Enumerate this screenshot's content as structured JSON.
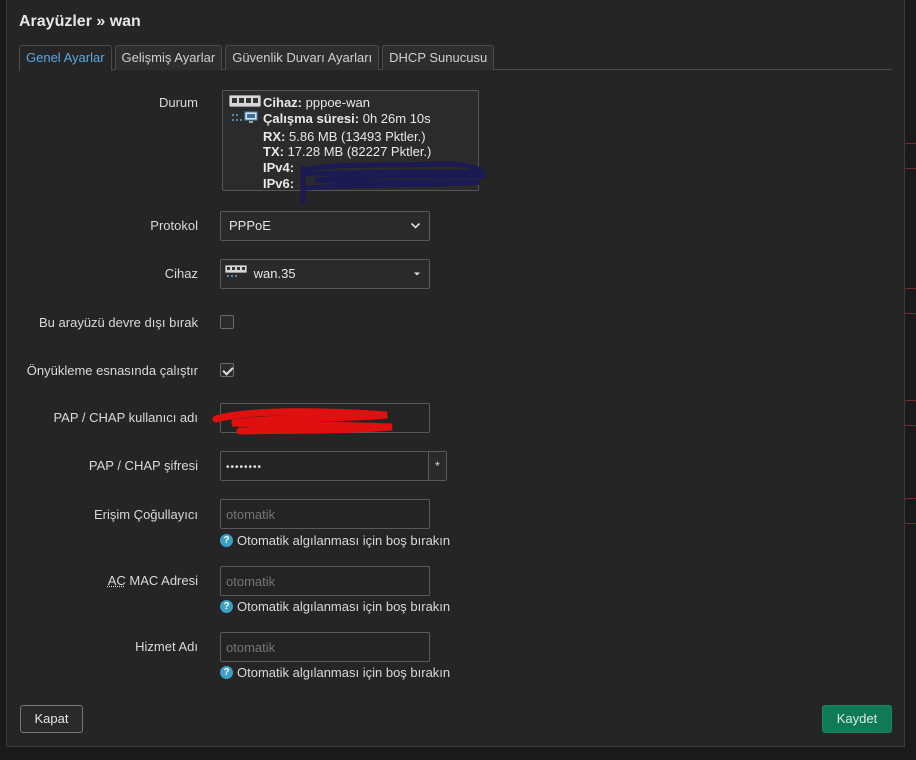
{
  "modal": {
    "title": "Arayüzler » wan"
  },
  "tabs": [
    {
      "label": "Genel Ayarlar",
      "active": true
    },
    {
      "label": "Gelişmiş Ayarlar",
      "active": false
    },
    {
      "label": "Güvenlik Duvarı Ayarları",
      "active": false
    },
    {
      "label": "DHCP Sunucusu",
      "active": false
    }
  ],
  "status": {
    "label": "Durum",
    "device_key": "Cihaz:",
    "device_value": "pppoe-wan",
    "uptime_key": "Çalışma süresi:",
    "uptime_value": "0h 26m 10s",
    "rx_key": "RX:",
    "rx_value": "5.86 MB (13493 Pktler.)",
    "tx_key": "TX:",
    "tx_value": "17.28 MB (82227 Pktler.)",
    "ipv4_key": "IPv4:",
    "ipv6_key": "IPv6:"
  },
  "protocol": {
    "label": "Protokol",
    "value": "PPPoE"
  },
  "device": {
    "label": "Cihaz",
    "value": "wan.35"
  },
  "disable": {
    "label": "Bu arayüzü devre dışı bırak",
    "checked": false
  },
  "autostart": {
    "label": "Önyükleme esnasında çalıştır",
    "checked": true
  },
  "username": {
    "label": "PAP / CHAP kullanıcı adı"
  },
  "password": {
    "label": "PAP / CHAP şifresi",
    "value": "••••••••",
    "reveal": "*"
  },
  "ac": {
    "label": "Erişim Çoğullayıcı",
    "placeholder": "otomatik",
    "help": "Otomatik algılanması için boş bırakın"
  },
  "ac_mac": {
    "label_abbr": "AC",
    "label_rest": " MAC Adresi",
    "placeholder": "otomatik",
    "help": "Otomatik algılanması için boş bırakın"
  },
  "service": {
    "label": "Hizmet Adı",
    "placeholder": "otomatik",
    "help": "Otomatik algılanması için boş bırakın"
  },
  "footer": {
    "close_label": "Kapat",
    "save_label": "Kaydet"
  },
  "colors": {
    "accent": "#5aa9e6",
    "save": "#0f7a55",
    "help": "#3aa0c8"
  }
}
